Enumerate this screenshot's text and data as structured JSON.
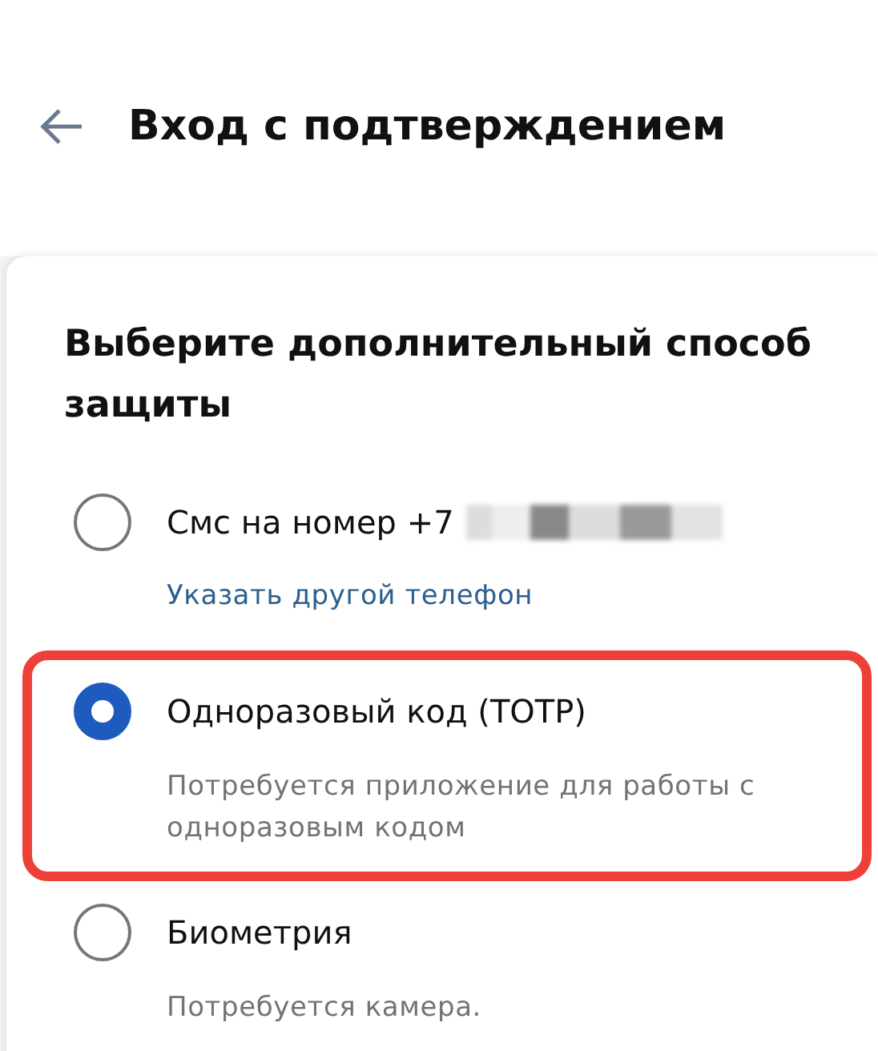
{
  "header": {
    "title": "Вход с подтверждением"
  },
  "card": {
    "heading": "Выберите дополнительный способ защиты",
    "options": [
      {
        "label": "Смс на номер +7",
        "masked_number": true,
        "selected": false,
        "highlighted": false,
        "link": "Указать другой телефон"
      },
      {
        "label": "Одноразовый код (TOTP)",
        "selected": true,
        "highlighted": true,
        "description": "Потребуется приложение для работы с одноразовым кодом"
      },
      {
        "label": "Биометрия",
        "selected": false,
        "highlighted": false,
        "description": "Потребуется камера."
      }
    ]
  }
}
